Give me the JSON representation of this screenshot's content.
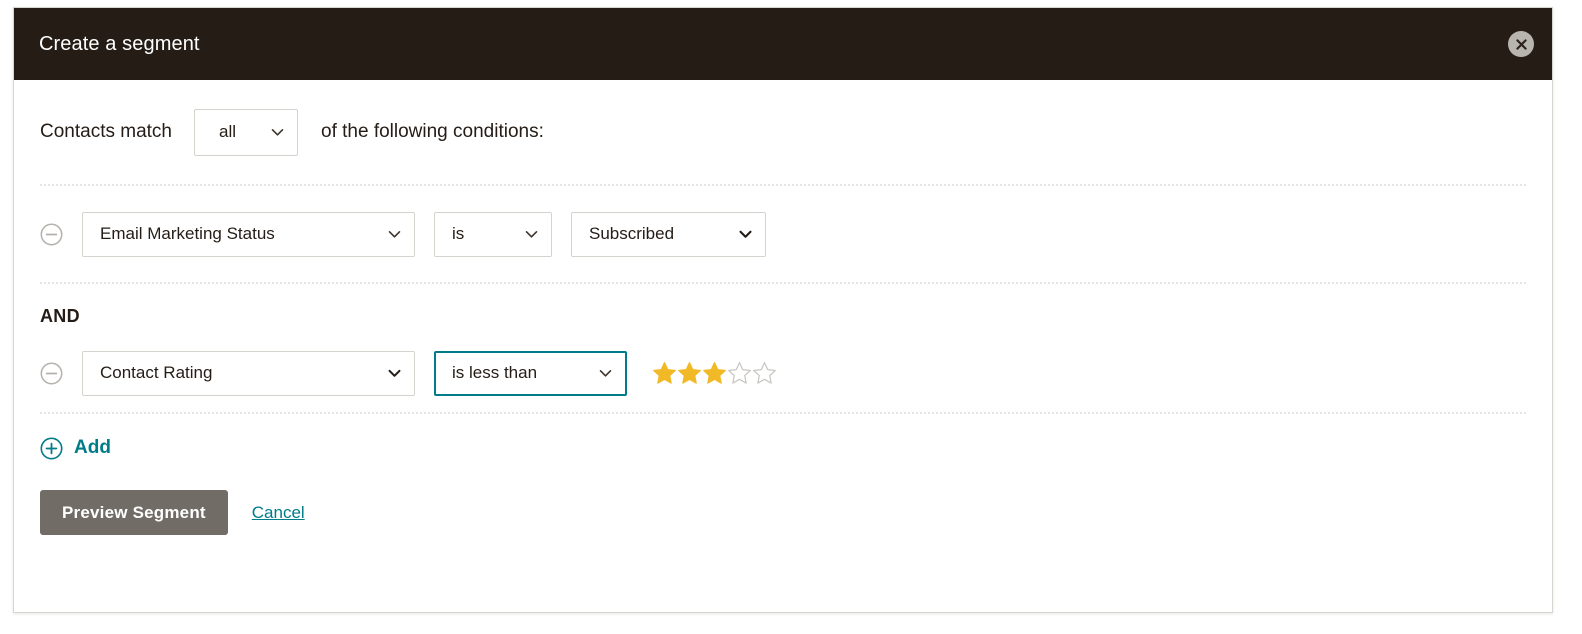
{
  "modal": {
    "title": "Create a segment",
    "close_icon": "close-icon"
  },
  "match": {
    "lead_text": "Contacts match",
    "selected": "all",
    "trail_text": "of the following conditions:",
    "caret_icon": "chevron-down-icon"
  },
  "conditions": [
    {
      "remove_icon": "minus-circle-icon",
      "field": "Email Marketing Status",
      "operator": "is",
      "value": "Subscribed",
      "operator_focused": false
    },
    {
      "conjunction": "AND",
      "remove_icon": "minus-circle-icon",
      "field": "Contact Rating",
      "operator": "is less than",
      "operator_focused": true,
      "rating": {
        "filled": 3,
        "total": 5,
        "filled_color": "#f2b927",
        "empty_color": "#c9c6c2"
      }
    }
  ],
  "add": {
    "label": "Add",
    "icon": "plus-circle-icon",
    "color": "#007c89"
  },
  "footer": {
    "primary_label": "Preview Segment",
    "primary_color": "#716c66",
    "cancel_label": "Cancel",
    "cancel_color": "#007c89"
  },
  "theme": {
    "header_bg": "#241c15",
    "accent": "#007c89",
    "border": "#d6d2cd"
  }
}
